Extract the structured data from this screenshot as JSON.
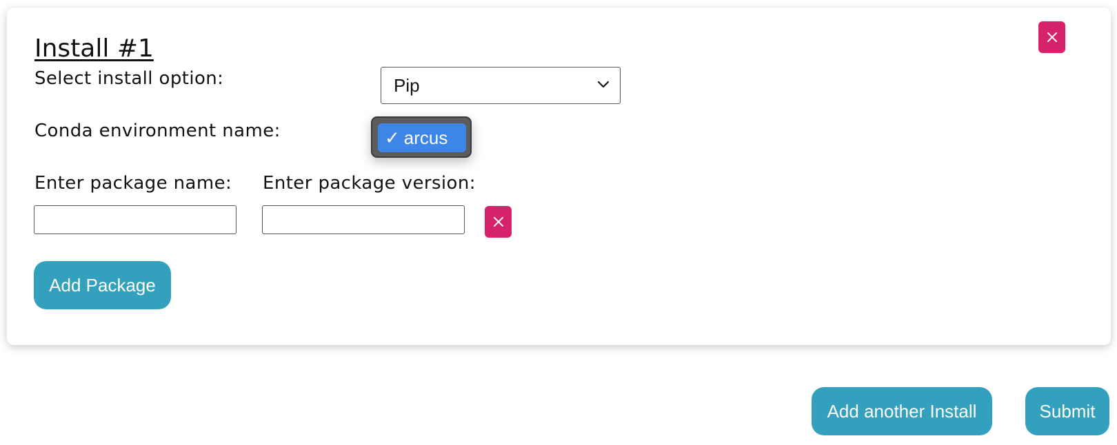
{
  "install": {
    "title": "Install #1",
    "install_option_label": "Select install option:",
    "install_option_value": "Pip",
    "conda_env_label": "Conda environment name:",
    "conda_env_selected": "arcus",
    "package_name_label": "Enter package name:",
    "package_version_label": "Enter package version:",
    "package_name_value": "",
    "package_version_value": "",
    "add_package_label": "Add Package"
  },
  "footer": {
    "add_install_label": "Add another Install",
    "submit_label": "Submit"
  },
  "colors": {
    "accent": "#33a1bd",
    "danger": "#d6226a",
    "dropdown_highlight": "#3d86e8"
  },
  "icons": {
    "close": "close-icon",
    "chevron": "chevron-down-icon",
    "check": "checkmark-icon"
  }
}
